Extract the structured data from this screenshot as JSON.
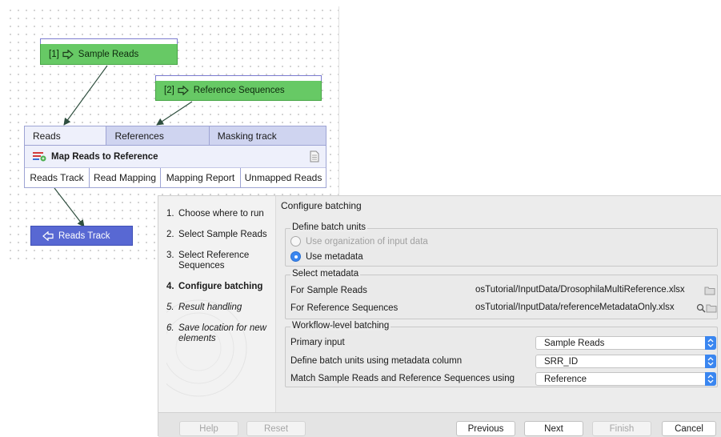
{
  "workflow": {
    "input_sample": {
      "index": "[1]",
      "label": "Sample Reads"
    },
    "input_reference": {
      "index": "[2]",
      "label": "Reference Sequences"
    },
    "tool": {
      "inputs": [
        "Reads",
        "References",
        "Masking track"
      ],
      "title": "Map Reads to Reference",
      "outputs": [
        "Reads Track",
        "Read Mapping",
        "Mapping Report",
        "Unmapped Reads"
      ]
    },
    "output": {
      "label": "Reads Track"
    }
  },
  "dialog": {
    "steps": [
      {
        "n": "1.",
        "label": "Choose where to run"
      },
      {
        "n": "2.",
        "label": "Select Sample Reads"
      },
      {
        "n": "3.",
        "label": "Select Reference Sequences"
      },
      {
        "n": "4.",
        "label": "Configure batching"
      },
      {
        "n": "5.",
        "label": "Result handling"
      },
      {
        "n": "6.",
        "label": "Save location for new elements"
      }
    ],
    "title": "Configure batching",
    "batch_units": {
      "legend": "Define batch units",
      "option_org": "Use organization of input data",
      "option_meta": "Use metadata"
    },
    "select_metadata": {
      "legend": "Select metadata",
      "sample_label": "For Sample Reads",
      "sample_path": "osTutorial/InputData/DrosophilaMultiReference.xlsx",
      "ref_label": "For Reference Sequences",
      "ref_path": "osTutorial/InputData/referenceMetadataOnly.xlsx"
    },
    "workflow_batching": {
      "legend": "Workflow-level batching",
      "primary_label": "Primary input",
      "primary_value": "Sample Reads",
      "column_label": "Define batch units using metadata column",
      "column_value": "SRR_ID",
      "match_label": "Match Sample Reads and Reference Sequences using",
      "match_value": "Reference"
    },
    "buttons": {
      "help": "Help",
      "reset": "Reset",
      "previous": "Previous",
      "next": "Next",
      "finish": "Finish",
      "cancel": "Cancel"
    }
  }
}
